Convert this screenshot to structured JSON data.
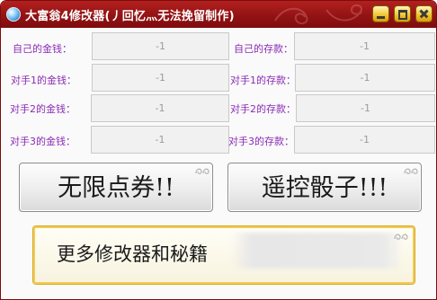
{
  "window": {
    "title": "大富翁4修改器(丿回忆灬无法挽留制作)",
    "title_bar_color": "#961617",
    "label_color": "#8a2bb5",
    "buttons": [
      "minimize-icon",
      "maximize-icon",
      "close-icon"
    ]
  },
  "fields": {
    "left": [
      {
        "label": "自己的金钱：",
        "value": "-1"
      },
      {
        "label": "对手1的金钱：",
        "value": "-1"
      },
      {
        "label": "对手2的金钱：",
        "value": "-1"
      },
      {
        "label": "对手3的金钱：",
        "value": "-1"
      }
    ],
    "right": [
      {
        "label": "自己的存款：",
        "value": "-1"
      },
      {
        "label": "对手1的存款：",
        "value": "-1"
      },
      {
        "label": "对手2的存款：",
        "value": "-1"
      },
      {
        "label": "对手3的存款：",
        "value": "-1"
      }
    ]
  },
  "buttons": {
    "unlimited": "无限点券!!",
    "dice": "遥控骰子!!!",
    "more": "更多修改器和秘籍"
  }
}
